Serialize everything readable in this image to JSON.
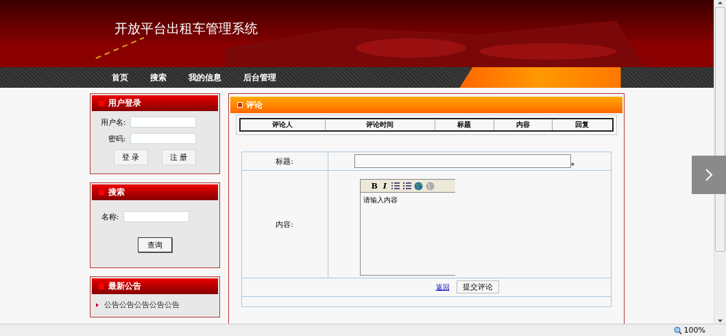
{
  "window": {
    "title": "开放平台出租车管理系统"
  },
  "nav": [
    "首页",
    "搜索",
    "我的信息",
    "后台管理"
  ],
  "login": {
    "title": "用户登录",
    "fields": [
      "用户名:",
      "密码:"
    ],
    "buttons": [
      "登 录",
      "注 册"
    ]
  },
  "search": {
    "title": "搜索",
    "field_label": "名称:",
    "button": "查询"
  },
  "notices": {
    "title": "最新公告",
    "items": [
      "公告公告公告公告公告"
    ]
  },
  "comments": {
    "title": "评论",
    "columns": [
      "评论人",
      "评论时间",
      "标题",
      "内容",
      "回复"
    ]
  },
  "form": {
    "title_label": "标题:",
    "required_mark": "*",
    "content_label": "内容:",
    "toolbar": [
      "B",
      "I"
    ],
    "content_value": "请输入内容",
    "back_link": "返回",
    "submit": "提交评论"
  },
  "status_bar": {
    "zoom": "100%"
  }
}
